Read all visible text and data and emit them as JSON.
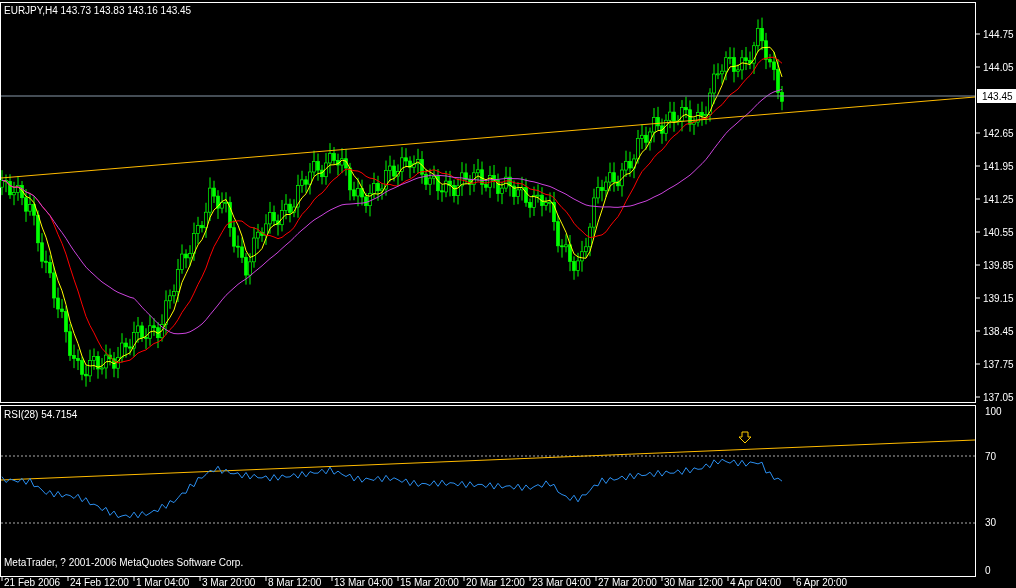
{
  "chart_header": "EURJPY,H4  143.73 143.83 143.16 143.45",
  "price_axis": [
    "144.75",
    "144.05",
    "142.65",
    "141.95",
    "141.25",
    "140.55",
    "139.85",
    "139.15",
    "138.45",
    "137.75",
    "137.05"
  ],
  "current_price": "143.45",
  "rsi_header": "RSI(28) 54.7154",
  "rsi_axis": [
    "100",
    "70",
    "30",
    "0"
  ],
  "copyright": "MetaTrader, ? 2001-2006 MetaQuotes Software Corp.",
  "time_axis": [
    "21 Feb 2006",
    "24 Feb 12:00",
    "1 Mar 04:00",
    "3 Mar 20:00",
    "8 Mar 12:00",
    "13 Mar 04:00",
    "15 Mar 20:00",
    "20 Mar 12:00",
    "23 Mar 04:00",
    "27 Mar 20:00",
    "30 Mar 12:00",
    "4 Apr 04:00",
    "6 Apr 20:00"
  ]
}
